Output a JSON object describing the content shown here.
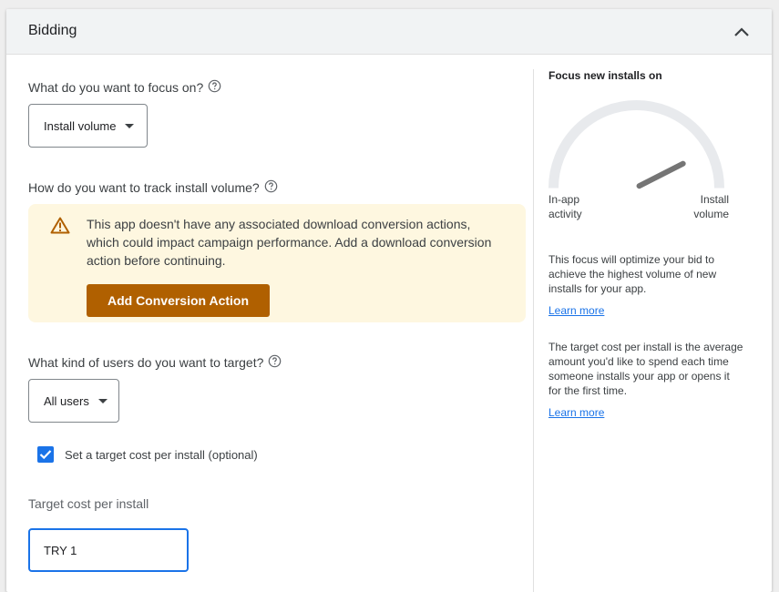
{
  "section": {
    "title": "Bidding"
  },
  "focus": {
    "question": "What do you want to focus on?",
    "selected": "Install volume"
  },
  "track": {
    "question": "How do you want to track install volume?"
  },
  "warning": {
    "message": "This app doesn't have any associated download conversion actions, which could impact campaign performance. Add a download conversion action before continuing.",
    "button_label": "Add Conversion Action"
  },
  "users": {
    "question": "What kind of users do you want to target?",
    "selected": "All users"
  },
  "target_cost": {
    "checkbox_label": "Set a target cost per install (optional)",
    "checked": true,
    "field_label": "Target cost per install",
    "value": "TRY 1"
  },
  "side_panel": {
    "title": "Focus new installs on",
    "gauge_left_label": "In-app activity",
    "gauge_right_label": "Install volume",
    "gauge_level": 0.85,
    "description_1": "This focus will optimize your bid to achieve the highest volume of new installs for your app.",
    "learn_more_1": "Learn more",
    "description_2": "The target cost per install is the average amount you'd like to spend each time someone installs your app or opens it for the first time.",
    "learn_more_2": "Learn more"
  },
  "colors": {
    "accent": "#1a73e8",
    "warning_bg": "#fef7e0",
    "warning_button": "#b06000"
  }
}
